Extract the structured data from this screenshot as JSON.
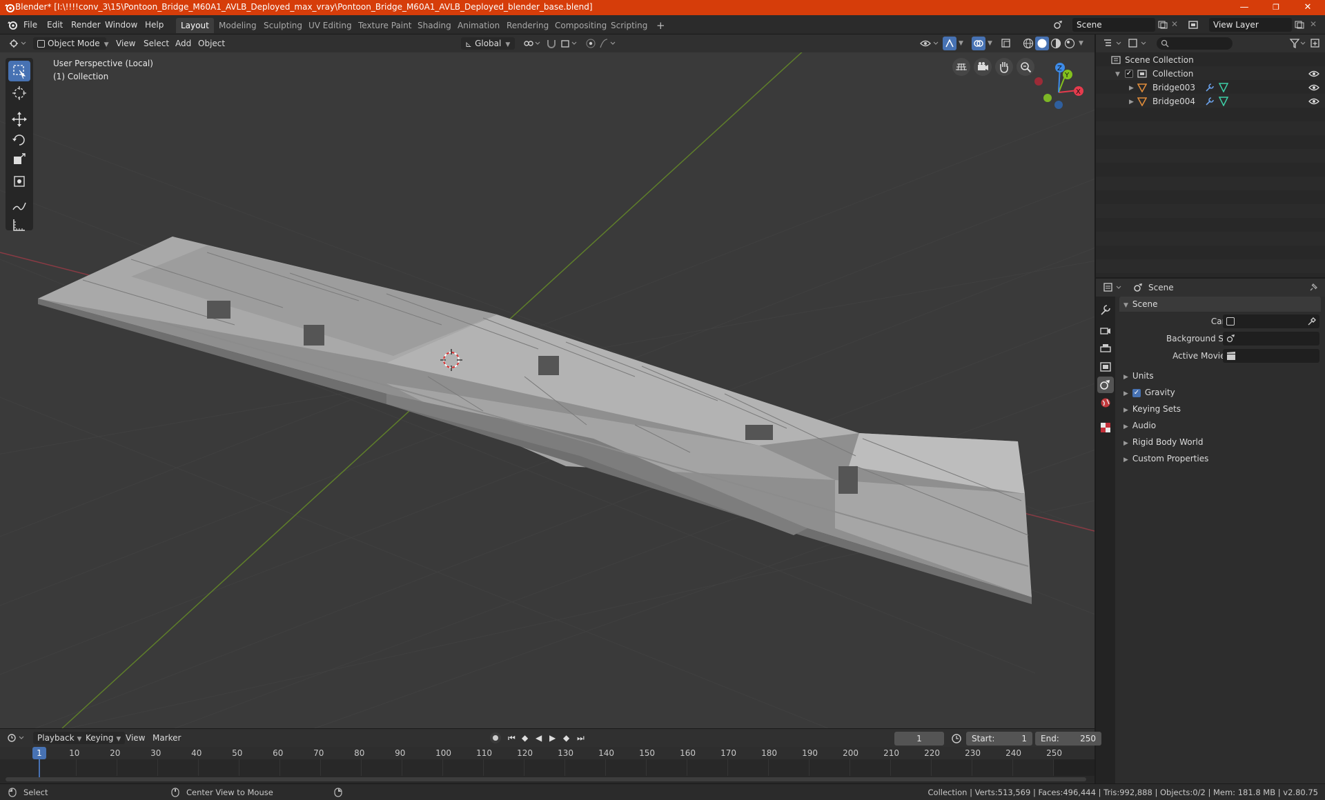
{
  "titlebar": {
    "title": "Blender* [I:\\!!!!conv_3\\15\\Pontoon_Bridge_M60A1_AVLB_Deployed_max_vray\\Pontoon_Bridge_M60A1_AVLB_Deployed_blender_base.blend]",
    "minimize": "—",
    "maximize": "❐",
    "close": "✕"
  },
  "menu": {
    "file": "File",
    "edit": "Edit",
    "render": "Render",
    "window": "Window",
    "help": "Help"
  },
  "workspaces": [
    "Layout",
    "Modeling",
    "Sculpting",
    "UV Editing",
    "Texture Paint",
    "Shading",
    "Animation",
    "Rendering",
    "Compositing",
    "Scripting"
  ],
  "add_workspace": "+",
  "scene_field": "Scene",
  "view_layer_field": "View Layer",
  "viewport_header": {
    "mode": "Object Mode",
    "view": "View",
    "select": "Select",
    "add": "Add",
    "object": "Object",
    "orientation": "Global"
  },
  "viewport": {
    "perspective": "User Perspective (Local)",
    "collection": "(1) Collection",
    "gizmo": {
      "x": "X",
      "y": "Y",
      "z": "Z"
    }
  },
  "outliner": {
    "scene_collection": "Scene Collection",
    "collection": "Collection",
    "objects": [
      "Bridge003",
      "Bridge004"
    ]
  },
  "properties": {
    "header": "Scene",
    "section": "Scene",
    "camera_label": "Camera",
    "bg_scene_label": "Background Scene",
    "movie_clip_label": "Active Movie Clip",
    "subsections": [
      "Units",
      "Gravity",
      "Keying Sets",
      "Audio",
      "Rigid Body World",
      "Custom Properties"
    ]
  },
  "timeline": {
    "playback": "Playback",
    "keying": "Keying",
    "view": "View",
    "marker": "Marker",
    "current_frame": "1",
    "start_label": "Start:",
    "start": "1",
    "end_label": "End:",
    "end": "250",
    "ticks": [
      "1",
      "10",
      "20",
      "30",
      "40",
      "50",
      "60",
      "70",
      "80",
      "90",
      "100",
      "110",
      "120",
      "130",
      "140",
      "150",
      "160",
      "170",
      "180",
      "190",
      "200",
      "210",
      "220",
      "230",
      "240",
      "250"
    ]
  },
  "statusbar": {
    "select": "Select",
    "center_view": "Center View to Mouse",
    "stats": "Collection | Verts:513,569 | Faces:496,444 | Tris:992,888 | Objects:0/2 | Mem: 181.8 MB | v2.80.75"
  },
  "colors": {
    "title_bar": "#d63d0a",
    "accent_blue": "#4772b3",
    "axis_x": "#e63b4d",
    "axis_y": "#83c11e",
    "axis_z": "#3d8be8",
    "object_mesh": "#b3b3b3"
  }
}
